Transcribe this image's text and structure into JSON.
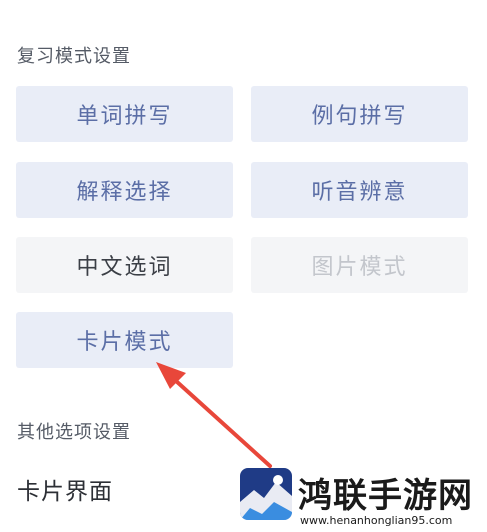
{
  "review_settings": {
    "title": "复习模式设置",
    "modes": [
      {
        "label": "单词拼写",
        "state": "selected"
      },
      {
        "label": "例句拼写",
        "state": "selected"
      },
      {
        "label": "解释选择",
        "state": "selected"
      },
      {
        "label": "听音辨意",
        "state": "selected"
      },
      {
        "label": "中文选词",
        "state": "unselected"
      },
      {
        "label": "图片模式",
        "state": "disabled"
      },
      {
        "label": "卡片模式",
        "state": "selected"
      }
    ]
  },
  "other_settings": {
    "title": "其他选项设置",
    "card_interface_label": "卡片界面"
  },
  "watermark": {
    "title": "鸿联手游网",
    "url": "www.henanhonglian95.com"
  },
  "colors": {
    "selected_bg": "#e9edf7",
    "selected_text": "#5b6ea6",
    "arrow": "#e8473a",
    "logo_bg": "#1f3b86"
  },
  "icons": {
    "annotation_arrow": "red-arrow-icon",
    "watermark_logo": "site-logo-icon"
  }
}
